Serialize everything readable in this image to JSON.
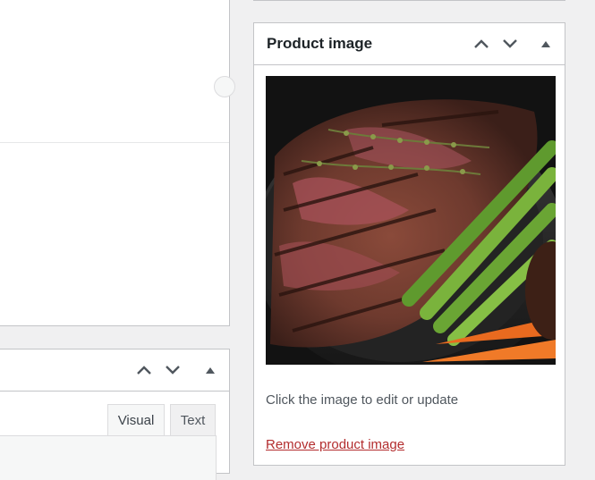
{
  "product_image_box": {
    "title": "Product image",
    "image_alt": "Grilled sliced steak with asparagus and carrots",
    "hint": "Click the image to edit or update",
    "remove_link": "Remove product image"
  },
  "editor": {
    "tabs": [
      "Visual",
      "Text"
    ]
  },
  "icons": {
    "move_up": "chevron-up-icon",
    "move_down": "chevron-down-icon",
    "toggle": "triangle-up-icon"
  },
  "colors": {
    "link_danger": "#b32d2e",
    "border": "#c3c4c7",
    "background": "#f0f0f1"
  }
}
